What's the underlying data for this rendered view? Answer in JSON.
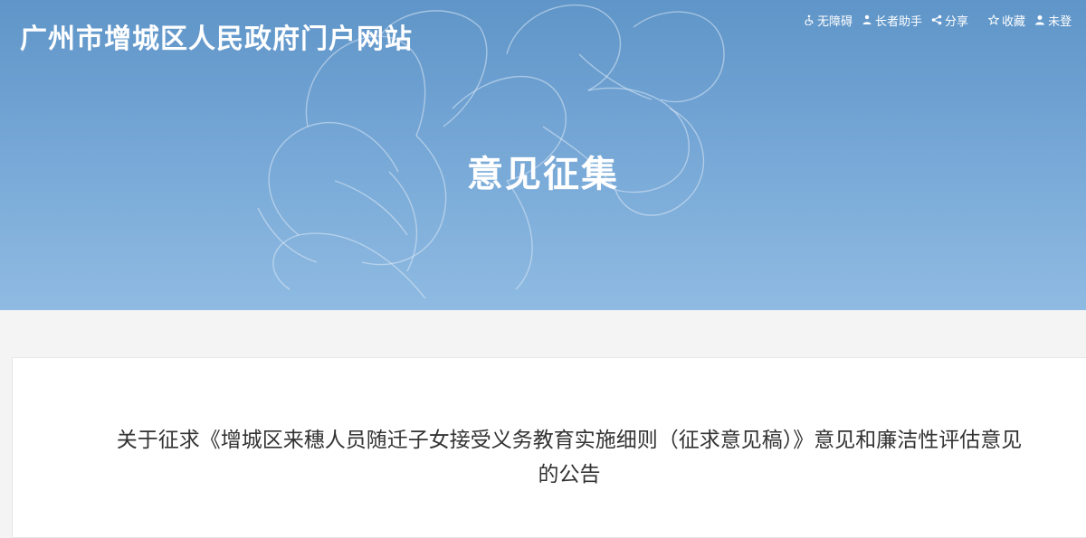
{
  "header": {
    "site_title": "广州市增城区人民政府门户网站",
    "links": [
      {
        "label": "无障碍",
        "icon": "accessibility-icon"
      },
      {
        "label": "长者助手",
        "icon": "elder-assistant-icon"
      },
      {
        "label": "分享",
        "icon": "share-icon"
      },
      {
        "label": "收藏",
        "icon": "star-icon"
      },
      {
        "label": "未登",
        "icon": "user-icon"
      }
    ]
  },
  "banner": {
    "heading": "意见征集",
    "background_color": "#72a4d4"
  },
  "main": {
    "notice_title": "关于征求《增城区来穗人员随迁子女接受义务教育实施细则（征求意见稿）》意见和廉洁性评估意见的公告"
  }
}
